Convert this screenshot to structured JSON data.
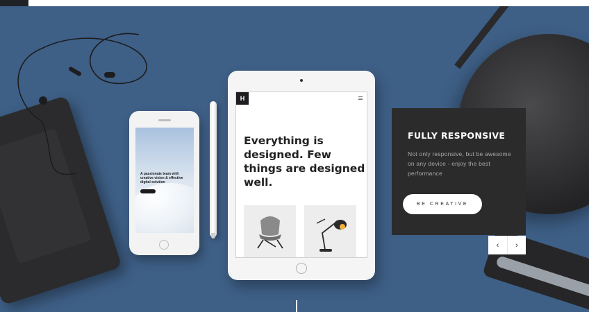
{
  "ipad": {
    "logo": "H",
    "headline": "Everything is designed. Few things are designed well."
  },
  "phone": {
    "headline": "A passionate team with creative vision & effective digital solution"
  },
  "feature_card": {
    "title": "FULLY RESPONSIVE",
    "description": "Not only responsive, but be awesome on any device - enjoy the best performance",
    "cta_label": "BE CREATIVE"
  },
  "slider": {
    "prev_glyph": "‹",
    "next_glyph": "›"
  },
  "colors": {
    "background": "#3e5f86",
    "card": "#2b2b2c",
    "dark": "#1d1d1f"
  }
}
